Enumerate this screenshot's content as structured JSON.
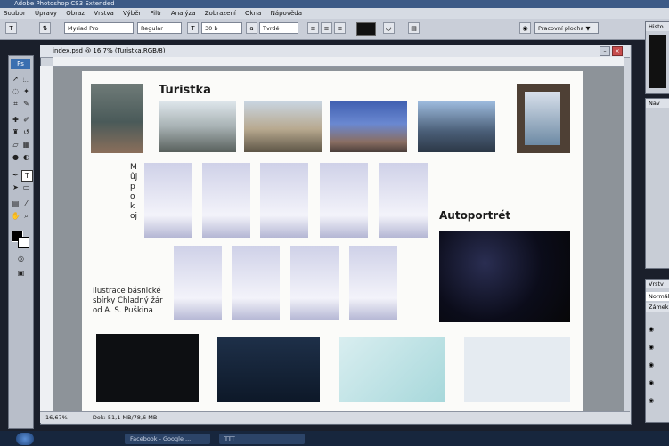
{
  "app": {
    "title": "Adobe Photoshop CS3 Extended"
  },
  "menu": [
    "Soubor",
    "Úpravy",
    "Obraz",
    "Vrstva",
    "Výběr",
    "Filtr",
    "Analýza",
    "Zobrazení",
    "Okna",
    "Nápověda"
  ],
  "options": {
    "font_family": "Myriad Pro",
    "font_style": "Regular",
    "font_size": "30 b",
    "antialias": "Tvrdé",
    "workspace": "Pracovní plocha ▼"
  },
  "document": {
    "title": "index.psd @ 16,7% (Turistka,RGB/8)",
    "zoom": "16,67%",
    "doc_size": "Dok: 51,1 MB/78,6 MB"
  },
  "artwork": {
    "heading_turistka": "Turistka",
    "heading_muj_pokoj": "Můj pokoj",
    "heading_autoportret": "Autoportrét",
    "caption_ilustrace": [
      "Ilustrace básnické",
      "sbírky Chladný žár",
      "od A. S. Puškina"
    ]
  },
  "panels": {
    "histogram": "Histo",
    "navigator": "Nav",
    "layers": "Vrstv",
    "blend": "Normál",
    "lock": "Zámek:"
  },
  "taskbar": {
    "items": [
      "Facebook - Google ...",
      "TTT"
    ]
  },
  "colors": {
    "accent": "#3c5a86",
    "canvas": "#fbfbf9"
  }
}
